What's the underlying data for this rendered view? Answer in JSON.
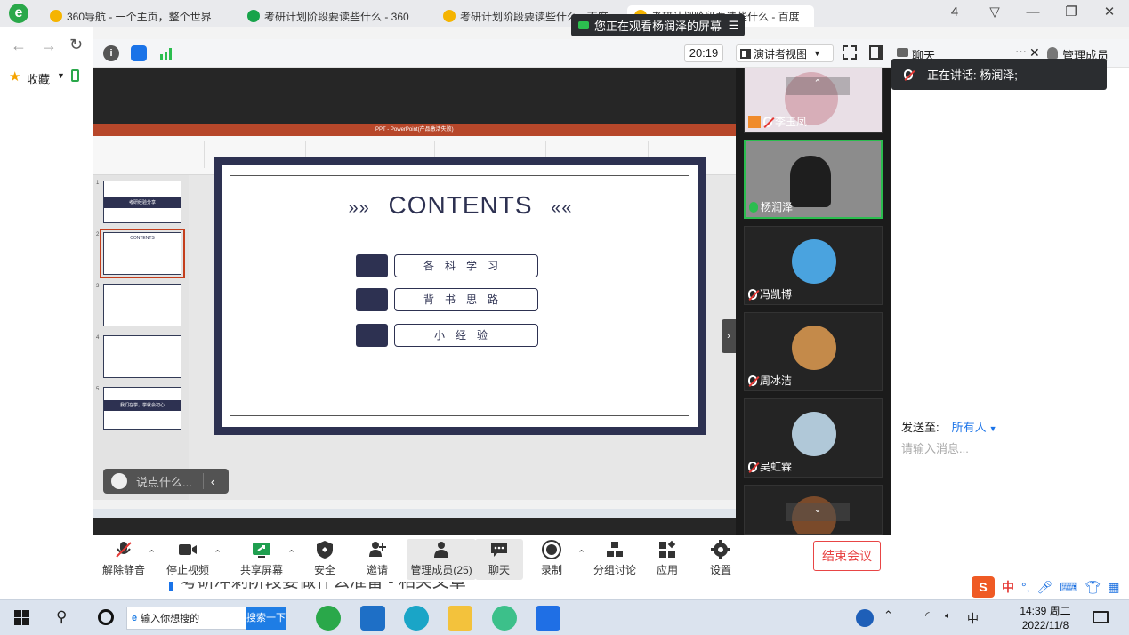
{
  "browser": {
    "tabs": [
      {
        "label": "360导航 - 一个主页，整个世界",
        "color": "#f5b400"
      },
      {
        "label": "考研计划阶段要读些什么 - 360",
        "color": "#17a34a"
      },
      {
        "label": "考研计划阶段要读些什么 - 百度",
        "color": "#f5b400"
      },
      {
        "label": "考研计划阶段要读些什么 - 百度",
        "color": "#f5b400"
      }
    ],
    "bookmarks_label": "收藏",
    "window_buttons": [
      "4",
      "▽",
      "—",
      "❐",
      "✕"
    ]
  },
  "meeting": {
    "banner": "您正在观看杨润泽的屏幕",
    "timer": "20:19",
    "view_label": "演讲者视图",
    "panel": {
      "chat_tab": "聊天",
      "members_tab": "管理成员(25)",
      "speaking": "正在讲话: 杨润泽;",
      "send_to_label": "发送至:",
      "send_to_value": "所有人",
      "input_placeholder": "请输入消息..."
    },
    "chat_pill_placeholder": "说点什么...",
    "slide": {
      "title": "CONTENTS",
      "items": [
        "各科学习",
        "背书思路",
        "小经验"
      ]
    },
    "thumbs": [
      {
        "num": "1",
        "text": "考研经验分享"
      },
      {
        "num": "2",
        "text": "CONTENTS"
      },
      {
        "num": "3",
        "text": ""
      },
      {
        "num": "4",
        "text": ""
      },
      {
        "num": "5",
        "text": "我们在学，学就会初心"
      }
    ],
    "ppt_title": "PPT - PowerPoint(产品激活失败)",
    "participants": [
      {
        "name": "李玉凤",
        "type": "video-girl"
      },
      {
        "name": "杨润泽",
        "type": "video-boy",
        "active": true
      },
      {
        "name": "冯凯博",
        "type": "avatar",
        "color": "#4aa3df"
      },
      {
        "name": "周冰洁",
        "type": "avatar",
        "color": "#c48a4a"
      },
      {
        "name": "吴虹霖",
        "type": "avatar",
        "color": "#b0c8d8"
      }
    ],
    "toolbar": [
      {
        "label": "解除静音",
        "icon": "mic-muted-icon"
      },
      {
        "label": "停止视频",
        "icon": "video-icon"
      },
      {
        "label": "共享屏幕",
        "icon": "share-screen-icon"
      },
      {
        "label": "安全",
        "icon": "shield-icon"
      },
      {
        "label": "邀请",
        "icon": "invite-icon"
      },
      {
        "label": "管理成员(25)",
        "icon": "members-icon"
      },
      {
        "label": "聊天",
        "icon": "chat-icon"
      },
      {
        "label": "录制",
        "icon": "record-icon"
      },
      {
        "label": "分组讨论",
        "icon": "breakout-icon"
      },
      {
        "label": "应用",
        "icon": "apps-icon"
      },
      {
        "label": "设置",
        "icon": "settings-icon"
      }
    ],
    "end_label": "结束会议"
  },
  "page": {
    "article_text": "考研冲刺阶段要做什么准备 - 相关文章"
  },
  "taskbar": {
    "search_placeholder": "输入你想搜的",
    "search_button": "搜索一下",
    "time": "14:39 周二",
    "date": "2022/11/8"
  },
  "ime": {
    "label": "中"
  }
}
